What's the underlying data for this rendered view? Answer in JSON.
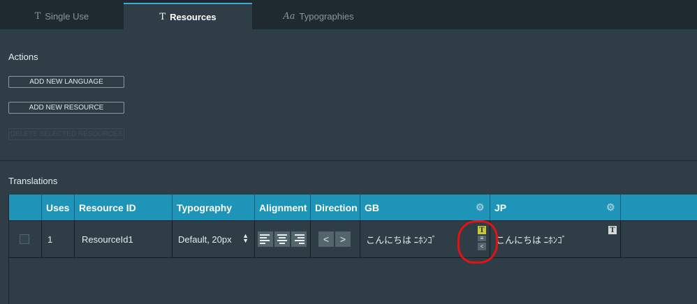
{
  "tabs": [
    {
      "icon": "T",
      "label": "Single Use"
    },
    {
      "icon": "T",
      "label": "Resources"
    },
    {
      "icon": "Aa",
      "label": "Typographies"
    }
  ],
  "actions": {
    "title": "Actions",
    "add_language": "ADD NEW LANGUAGE",
    "add_resource": "ADD NEW RESOURCE",
    "delete_resources": "DELETE SELECTED RESOURCES"
  },
  "translations": {
    "title": "Translations",
    "headers": {
      "uses": "Uses",
      "resource_id": "Resource ID",
      "typography": "Typography",
      "alignment": "Alignment",
      "direction": "Direction",
      "gb": "GB",
      "jp": "JP"
    },
    "rows": [
      {
        "uses": "1",
        "resource_id": "ResourceId1",
        "typography": "Default, 20px",
        "gb": "こんにちは ﾆﾎﾝｺﾞ",
        "jp": "こんにちは ﾆﾎﾝｺﾞ"
      }
    ]
  },
  "icons": {
    "text_button": "T",
    "prev": "<",
    "next": ">",
    "gear": "⚙"
  },
  "colors": {
    "accent": "#1d94b8",
    "highlight": "#c9c83c",
    "annotation": "#e01414"
  }
}
